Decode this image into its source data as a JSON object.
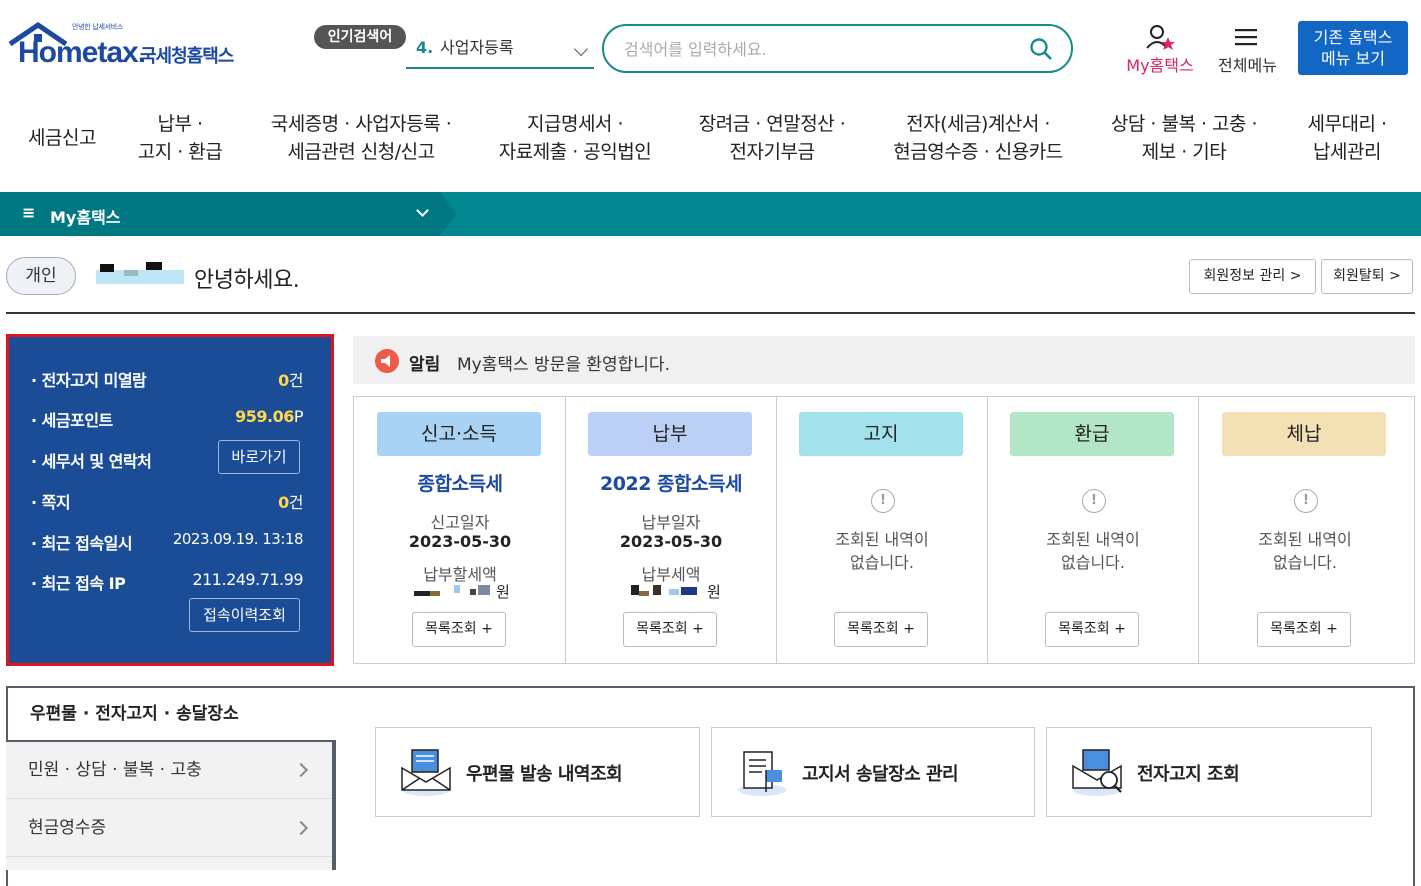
{
  "header": {
    "logo_tagline": "안녕한 납세서비스",
    "logo_word": "Hometax.",
    "logo_korean": "국세청홈택스",
    "popular_label": "인기검색어",
    "popular_rank": "4.",
    "popular_keyword": "사업자등록",
    "search_placeholder": "검색어를 입력하세요.",
    "my_hometax": "My홈택스",
    "all_menu": "전체메뉴",
    "old_hometax_line1": "기존 홈택스",
    "old_hometax_line2": "메뉴 보기"
  },
  "gnb": [
    {
      "l1": "세금신고",
      "l2": ""
    },
    {
      "l1": "납부 ·",
      "l2": "고지 · 환급"
    },
    {
      "l1": "국세증명 · 사업자등록 ·",
      "l2": "세금관련 신청/신고"
    },
    {
      "l1": "지급명세서 ·",
      "l2": "자료제출 · 공익법인"
    },
    {
      "l1": "장려금 · 연말정산 ·",
      "l2": "전자기부금"
    },
    {
      "l1": "전자(세금)계산서 ·",
      "l2": "현금영수증 · 신용카드"
    },
    {
      "l1": "상담 · 불복 · 고충 ·",
      "l2": "제보 · 기타"
    },
    {
      "l1": "세무대리 ·",
      "l2": "납세관리"
    }
  ],
  "breadcrumb": {
    "menu": "My홈택스"
  },
  "greeting": {
    "user_type": "개인",
    "text": "안녕하세요.",
    "member_info_btn": "회원정보 관리 >",
    "withdraw_btn": "회원탈퇴 >"
  },
  "info_panel": {
    "unread_notice_label": "전자고지 미열람",
    "unread_notice_value": "0",
    "unread_notice_unit": "건",
    "tax_point_label": "세금포인트",
    "tax_point_value": "959.06",
    "tax_point_unit": "P",
    "office_label": "세무서 및 연락처",
    "office_btn": "바로가기",
    "memo_label": "쪽지",
    "memo_value": "0",
    "memo_unit": "건",
    "last_login_label": "최근 접속일시",
    "last_login_value": "2023.09.19.  13:18",
    "last_ip_label": "최근 접속 IP",
    "last_ip_value": "211.249.71.99",
    "history_btn": "접속이력조회"
  },
  "notice": {
    "title": "알림",
    "text": "My홈택스 방문을 환영합니다."
  },
  "cards": [
    {
      "badge": "신고·소득",
      "color": "#a9d3f5",
      "tax": "종합소득세",
      "date_label": "신고일자",
      "date": "2023-05-30",
      "amount_label": "납부할세액",
      "won": "원",
      "button": "목록조회 +"
    },
    {
      "badge": "납부",
      "color": "#bcd0f5",
      "tax": "2022 종합소득세",
      "date_label": "납부일자",
      "date": "2023-05-30",
      "amount_label": "납부세액",
      "won": "원",
      "button": "목록조회 +"
    },
    {
      "badge": "고지",
      "color": "#a3e2ec",
      "empty1": "조회된 내역이",
      "empty2": "없습니다.",
      "button": "목록조회 +"
    },
    {
      "badge": "환급",
      "color": "#b2e6c6",
      "empty1": "조회된 내역이",
      "empty2": "없습니다.",
      "button": "목록조회 +"
    },
    {
      "badge": "체납",
      "color": "#f2e1b4",
      "empty1": "조회된 내역이",
      "empty2": "없습니다.",
      "button": "목록조회 +"
    }
  ],
  "bottom": {
    "active_tab": "우편물 · 전자고지 · 송달장소",
    "side_items": [
      "민원 · 상담 · 불복 · 고충",
      "현금영수증"
    ],
    "quick": [
      "우편물 발송 내역조회",
      "고지서 송달장소 관리",
      "전자고지 조회"
    ]
  },
  "colors": {
    "brand": "#1d4aa0",
    "teal": "#00878f",
    "panel": "#1b4d96",
    "highlight": "#e0141b"
  }
}
